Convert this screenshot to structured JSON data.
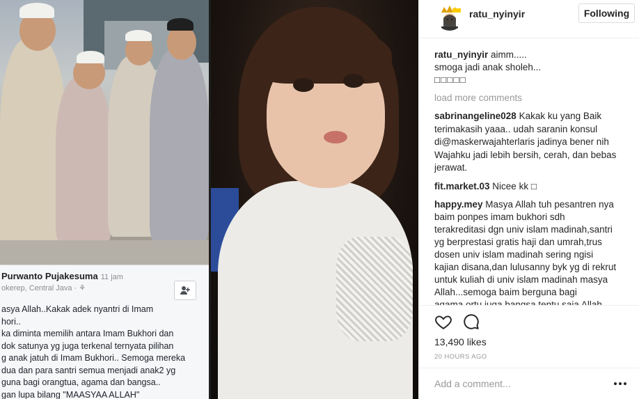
{
  "embedded_post": {
    "author": "Purwanto Pujakesuma",
    "time": "11 jam",
    "location": "okerep, Central Java · ⚘",
    "add_friend_icon": "add-friend-icon",
    "text_lines": [
      "asya Allah..Kakak adek nyantri di Imam",
      "hori..",
      "ka diminta memilih antara Imam Bukhori dan",
      "dok satunya yg juga terkenal ternyata pilihan",
      "g anak jatuh di Imam Bukhori.. Semoga mereka",
      "dua dan para santri semua menjadi anak2 yg",
      "guna bagi orangtua, agama dan bangsa..",
      "gan lupa bilang \"MAASYAA ALLAH\""
    ]
  },
  "header": {
    "username": "ratu_nyinyir",
    "follow_label": "Following",
    "avatar_icon": "profile-avatar-icon"
  },
  "caption": {
    "user": "ratu_nyinyir",
    "line1": " aimm.....",
    "line2": "smoga jadi anak sholeh...",
    "line3": "□□□□□"
  },
  "load_more": "load more comments",
  "comments": [
    {
      "user": "sabrinangeline028",
      "first": " Kakak ku yang Baik",
      "lines": [
        "terimakasih yaaa.. udah saranin konsul",
        "di@maskerwajahterlaris jadinya bener nih",
        "Wajahku jadi lebih bersih, cerah, dan bebas",
        "jerawat."
      ]
    },
    {
      "user": "fit.market.03",
      "first": " Nicee kk □",
      "lines": []
    },
    {
      "user": "happy.mey",
      "first": " Masya Allah tuh pesantren nya",
      "lines": [
        "baim ponpes imam bukhori sdh",
        "terakreditasi dgn univ islam madinah,santri",
        "yg berprestasi gratis haji dan umrah,trus",
        "dosen univ islam madinah sering ngisi",
        "kajian disana,dan lulusanny byk yg di rekrut",
        "untuk kuliah di univ islam madinah masya",
        "Allah...semoga baim berguna bagi",
        "agama,ortu,juga bangsa tentu saja Allah"
      ]
    }
  ],
  "actions": {
    "like_icon": "heart-icon",
    "comment_icon": "comment-icon",
    "likes": "13,490 likes",
    "time_ago": "20 HOURS AGO"
  },
  "add_comment": {
    "placeholder": "Add a comment...",
    "more_icon": "more-options-icon"
  }
}
